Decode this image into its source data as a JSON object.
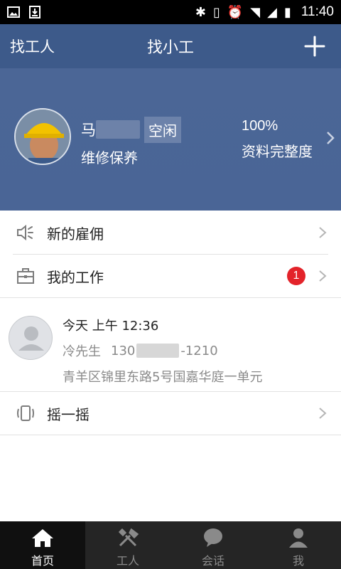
{
  "status_bar": {
    "time": "11:40"
  },
  "header": {
    "left_label": "找工人",
    "title": "找小工"
  },
  "profile": {
    "name_visible": "马",
    "status_tag": "空闲",
    "job": "维修保养",
    "completion_value": "100%",
    "completion_label": "资料完整度"
  },
  "menu": {
    "new_hire": "新的雇佣",
    "my_work": "我的工作",
    "my_work_badge": "1",
    "shake": "摇一摇"
  },
  "job_card": {
    "time": "今天 上午  12:36",
    "contact_name": "冷先生",
    "phone_prefix": "130",
    "phone_suffix": "-1210",
    "address": "青羊区锦里东路5号国嘉华庭一单元"
  },
  "nav": {
    "tabs": [
      {
        "label": "首页",
        "icon": "home-icon"
      },
      {
        "label": "工人",
        "icon": "tools-icon"
      },
      {
        "label": "会话",
        "icon": "chat-icon"
      },
      {
        "label": "我",
        "icon": "user-icon"
      }
    ]
  },
  "colors": {
    "header": "#3d5a8a",
    "profile": "#4a6596",
    "badge": "#e3232a",
    "nav_bg": "#252525"
  }
}
